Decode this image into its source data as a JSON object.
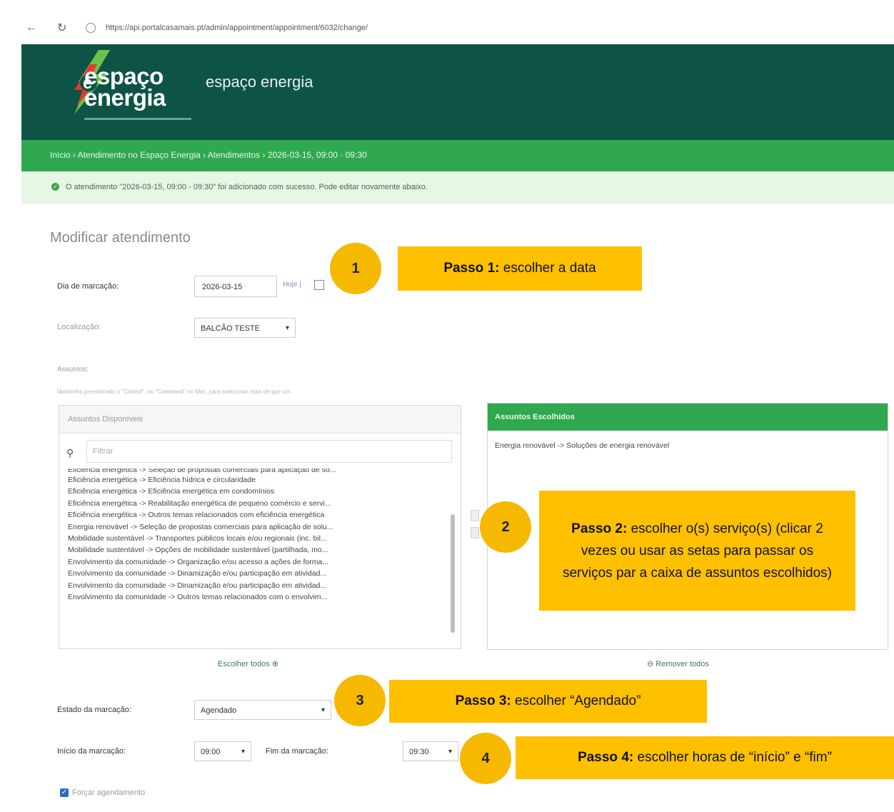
{
  "browser": {
    "back_icon": "arrow-left-icon",
    "reload_icon": "reload-icon",
    "url": "https://api.portalcasamais.pt/admin/appointment/appointment/6032/change/"
  },
  "header": {
    "logo_line1": "espaço",
    "logo_line2": "energia",
    "site_name": "espaço energia"
  },
  "breadcrumb": "Início › Atendimento no Espaço Energia › Atendimentos › 2026-03-15, 09:00 - 09:30",
  "message": "O atendimento \"2026-03-15, 09:00 - 09:30\" foi adicionado com sucesso. Pode editar novamente abaixo.",
  "page_title": "Modificar atendimento",
  "form": {
    "date_label": "Dia de marcação:",
    "date_value": "2026-03-15",
    "today_link": "Hoje |",
    "location_label": "Localização:",
    "location_value": "BALCÃO TESTE",
    "subjects_label": "Assuntos:",
    "subjects_help": "Mantenha pressionado o \"Control\", ou \"Command\" no Mac, para selecionar mais de que um.",
    "available_title": "Assuntos Disponíveis",
    "filter_placeholder": "Filtrar",
    "available_options": [
      "Eficiência energética -> Seleção de propostas comerciais para aplicação de so...",
      "Eficiência energética -> Eficiência hídrica e circularidade",
      "Eficiência energética -> Eficiência energética em condomínios",
      "Eficiência energética -> Reabilitação energética de pequeno comércio e servi...",
      "Eficiência energética -> Outros temas relacionados com eficiência energética",
      "Energia renovável -> Seleção de propostas comerciais para aplicação de solu...",
      "Mobilidade sustentável -> Transportes públicos locais e/ou regionais (inc. bil...",
      "Mobilidade sustentável -> Opções de mobilidade sustentável (partilhada, mo...",
      "Envolvimento da comunidade -> Organização e/ou acesso a ações de forma...",
      "Envolvimento da comunidade -> Dinamização e/ou participação em atividad...",
      "Envolvimento da comunidade -> Dinamização e/ou participação em atividad...",
      "Envolvimento da comunidade -> Outros temas relacionados com o envolvim..."
    ],
    "chosen_title": "Assuntos Escolhidos",
    "chosen_options": [
      "Energia renovável -> Soluções de energia renovável"
    ],
    "choose_all": "Escolher todos",
    "remove_all": "Remover todos",
    "status_label": "Estado da marcação:",
    "status_value": "Agendado",
    "start_label": "Início da marcação:",
    "start_value": "09:00",
    "end_label": "Fim da marcação:",
    "end_value": "09:30",
    "force_label": "Forçar agendamento",
    "force_checked": true
  },
  "callouts": [
    {
      "number": "1",
      "bold": "Passo 1:",
      "text": " escolher a data"
    },
    {
      "number": "2",
      "bold": "Passo 2:",
      "text": " escolher o(s) serviço(s) (clicar 2 vezes ou usar as setas para passar os serviços par a caixa de assuntos escolhidos)"
    },
    {
      "number": "3",
      "bold": "Passo 3:",
      "text": " escolher “Agendado”"
    },
    {
      "number": "4",
      "bold": "Passo 4:",
      "text": " escolher horas de “início” e “fim”"
    }
  ],
  "colors": {
    "header_bg": "#0d5446",
    "breadcrumb_bg": "#2fa84f",
    "message_bg": "#e6f7e5",
    "callout_bg": "#ffc000",
    "circle_bg": "#f6b900"
  }
}
